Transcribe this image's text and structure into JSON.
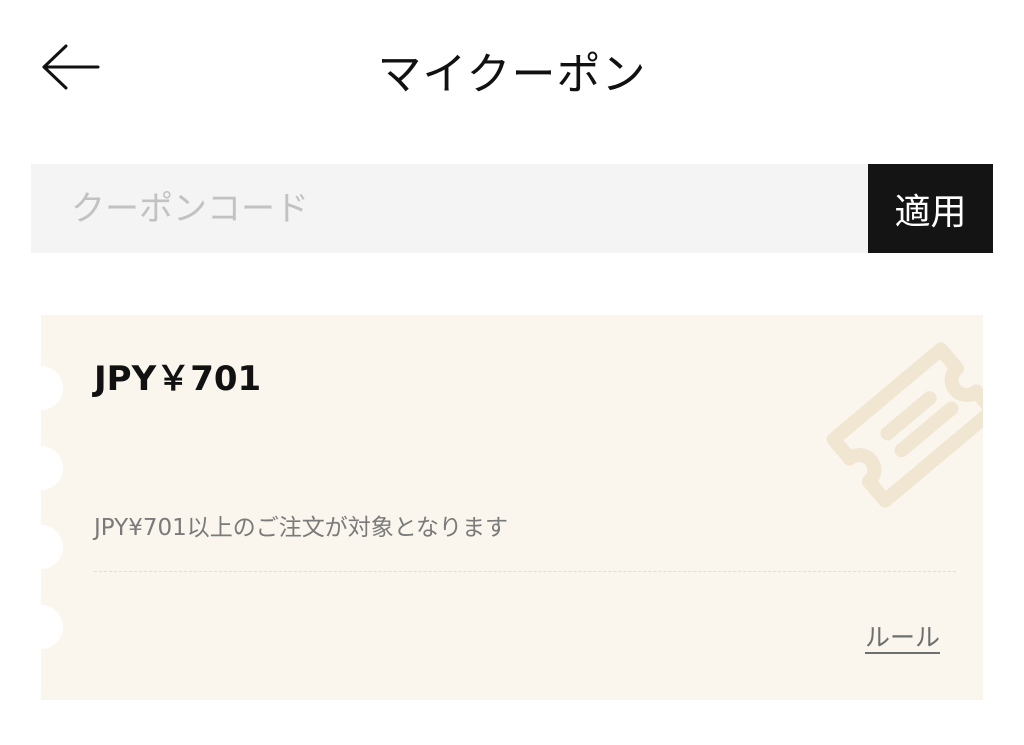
{
  "header": {
    "title": "マイクーポン",
    "back_icon": "arrow-left-icon"
  },
  "coupon_code": {
    "placeholder": "クーポンコード",
    "value": "",
    "apply_label": "適用"
  },
  "coupons": [
    {
      "amount": "JPY￥701",
      "condition": "JPY¥701以上のご注文が対象となります",
      "rules_label": "ルール",
      "icon": "ticket-icon"
    }
  ],
  "colors": {
    "card_background": "#faf6ee",
    "input_background": "#f4f4f4",
    "button_background": "#141414",
    "ticket_icon": "#f1e6d2"
  }
}
